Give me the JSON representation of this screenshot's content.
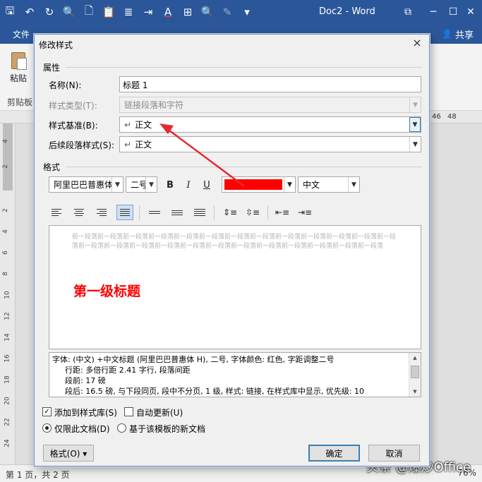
{
  "window": {
    "doc_title": "Doc2 - Word",
    "restore_icon": "⧉",
    "minimize_icon": "─",
    "maximize_icon": "☐",
    "close_icon": "✕"
  },
  "qat": {
    "save": "🖫",
    "undo": "↶",
    "redo": "↻",
    "print_preview": "🔍",
    "new": "🗋",
    "paste": "📋",
    "paragraph": "≣",
    "indent": "⇥",
    "font_color": "A",
    "table": "⊞",
    "find": "🔍",
    "draw": "✎",
    "more": "▾"
  },
  "tabs": {
    "file": "文件",
    "share": "共享",
    "share_icon": "👤"
  },
  "ribbon": {
    "paste_label": "粘贴",
    "clipboard_label": "剪贴板"
  },
  "ruler": {
    "marks": [
      "46",
      "48"
    ]
  },
  "vruler": [
    "4",
    "2",
    "",
    "2",
    "4",
    "6",
    "8",
    "10",
    "12",
    "14",
    "16",
    "18",
    "20",
    "22",
    "24"
  ],
  "status": {
    "page": "第 1 页，共 2 页",
    "zoom": "76%"
  },
  "watermark": "头条 @爆炒Office",
  "dialog": {
    "title": "修改样式",
    "close": "×",
    "properties": {
      "section": "属性",
      "name_label": "名称(N):",
      "name_value": "标题 1",
      "type_label": "样式类型(T):",
      "type_value": "链接段落和字符",
      "based_label": "样式基准(B):",
      "based_value": "正文",
      "next_label": "后续段落样式(S):",
      "next_value": "正文",
      "para_mark": "↵"
    },
    "format": {
      "section": "格式",
      "font": "阿里巴巴普惠体",
      "size": "二号",
      "bold": "B",
      "italic": "I",
      "underline": "U",
      "color": "#ff0000",
      "script": "中文"
    },
    "preview": {
      "prev_text": "前一段落前一段落前一段落前一段落前一段落前一段落前一段落前一段落前一段落前一段落前一段落前一段落前一段落前一段落前一段落前一段落前一段落前一段落前一段落前一段落前一段落前一段落前一段落前一段落前一段落",
      "sample": "第一级标题"
    },
    "description": {
      "line1": "字体: (中文) +中文标题 (阿里巴巴普惠体 H), 二号, 字体颜色: 红色, 字距调整二号",
      "line2": "行距: 多倍行距 2.41 字行, 段落间距",
      "line3": "段前: 17 磅",
      "line4": "段后: 16.5 磅, 与下段同页, 段中不分页, 1 级, 样式: 链接, 在样式库中显示, 优先级: 10"
    },
    "options": {
      "add_gallery": "添加到样式库(S)",
      "auto_update": "自动更新(U)",
      "only_doc": "仅限此文档(D)",
      "new_docs": "基于该模板的新文档",
      "check_mark": "✓"
    },
    "buttons": {
      "format": "格式(O) ▾",
      "ok": "确定",
      "cancel": "取消"
    }
  }
}
